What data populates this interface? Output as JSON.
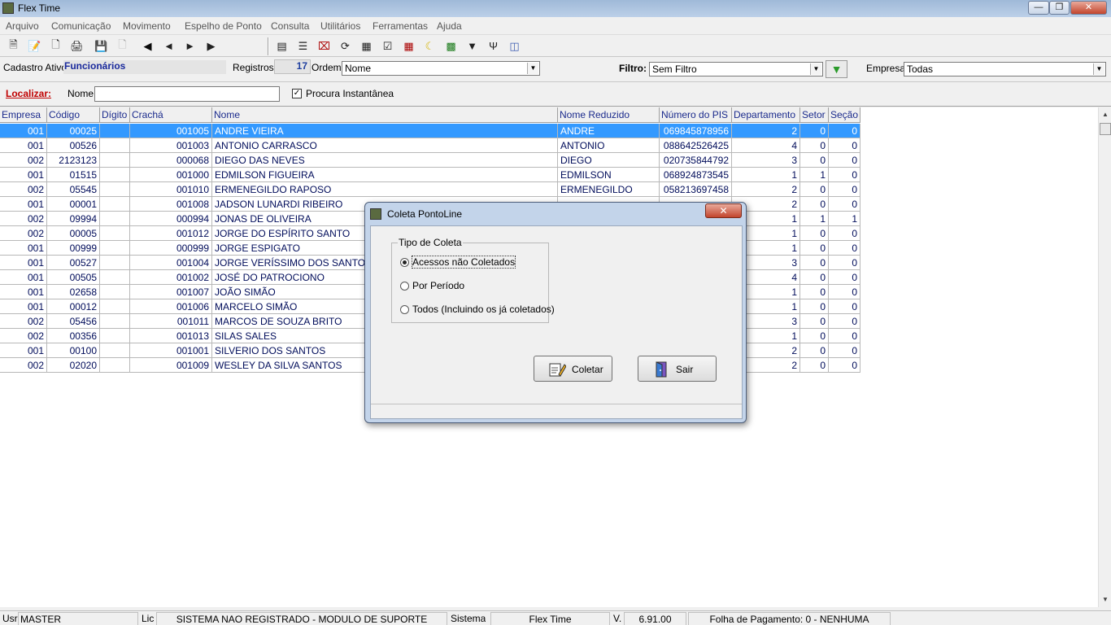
{
  "window": {
    "title": "Flex Time"
  },
  "menu": [
    "Arquivo",
    "Comunicação",
    "Movimento",
    "Espelho de Ponto",
    "Consulta",
    "Utilitários",
    "Ferramentas",
    "Ajuda"
  ],
  "toolbar": {
    "left_icons": [
      "new-record-icon",
      "edit-record-icon",
      "copy-record-icon",
      "print-icon",
      "save-icon",
      "blank-document-icon"
    ],
    "nav_icons": [
      "first-record-icon",
      "previous-record-icon",
      "next-record-icon",
      "last-record-icon"
    ],
    "right_icons": [
      "report-icon",
      "list-icon",
      "close-box-icon",
      "refresh-icon",
      "grid-icon",
      "checklist-icon",
      "calendar-icon",
      "moon-icon",
      "excel-icon",
      "filter-funnel-icon",
      "fork-icon",
      "network-icon"
    ]
  },
  "cadastro": {
    "label": "Cadastro Ativo:",
    "value": "Funcionários"
  },
  "registros": {
    "label": "Registros:",
    "count": "17"
  },
  "ordem": {
    "label": "Ordem:",
    "value": "Nome"
  },
  "filtro": {
    "label": "Filtro:",
    "value": "Sem Filtro"
  },
  "empresa": {
    "label": "Empresa:",
    "value": "Todas"
  },
  "localizar": {
    "label": "Localizar:",
    "field_label": "Nome",
    "value": "",
    "checkbox_label": "Procura Instantânea",
    "checked": true
  },
  "grid": {
    "columns": [
      "Empresa",
      "Código",
      "Dígito",
      "Crachá",
      "Nome",
      "Nome Reduzido",
      "Número do PIS",
      "Departamento",
      "Setor",
      "Seção"
    ],
    "rows": [
      [
        "001",
        "00025",
        "",
        "001005",
        "ANDRE VIEIRA",
        "ANDRE",
        "069845878956",
        "2",
        "0",
        "0"
      ],
      [
        "001",
        "00526",
        "",
        "001003",
        "ANTONIO CARRASCO",
        "ANTONIO",
        "088642526425",
        "4",
        "0",
        "0"
      ],
      [
        "002",
        "2123123",
        "",
        "000068",
        "DIEGO DAS NEVES",
        "DIEGO",
        "020735844792",
        "3",
        "0",
        "0"
      ],
      [
        "001",
        "01515",
        "",
        "001000",
        "EDMILSON FIGUEIRA",
        "EDMILSON",
        "068924873545",
        "1",
        "1",
        "0"
      ],
      [
        "002",
        "05545",
        "",
        "001010",
        "ERMENEGILDO RAPOSO",
        "ERMENEGILDO",
        "058213697458",
        "2",
        "0",
        "0"
      ],
      [
        "001",
        "00001",
        "",
        "001008",
        "JADSON LUNARDI RIBEIRO",
        "",
        "",
        "2",
        "0",
        "0"
      ],
      [
        "002",
        "09994",
        "",
        "000994",
        "JONAS DE OLIVEIRA",
        "",
        "",
        "1",
        "1",
        "1"
      ],
      [
        "002",
        "00005",
        "",
        "001012",
        "JORGE DO ESPÍRITO SANTO",
        "",
        "",
        "1",
        "0",
        "0"
      ],
      [
        "001",
        "00999",
        "",
        "000999",
        "JORGE ESPIGATO",
        "",
        "",
        "1",
        "0",
        "0"
      ],
      [
        "001",
        "00527",
        "",
        "001004",
        "JORGE VERÍSSIMO DOS SANTOS",
        "",
        "",
        "3",
        "0",
        "0"
      ],
      [
        "001",
        "00505",
        "",
        "001002",
        "JOSÉ DO PATROCIONO",
        "",
        "",
        "4",
        "0",
        "0"
      ],
      [
        "001",
        "02658",
        "",
        "001007",
        "JOÃO SIMÃO",
        "",
        "",
        "1",
        "0",
        "0"
      ],
      [
        "001",
        "00012",
        "",
        "001006",
        "MARCELO SIMÃO",
        "",
        "",
        "1",
        "0",
        "0"
      ],
      [
        "002",
        "05456",
        "",
        "001011",
        "MARCOS DE SOUZA BRITO",
        "",
        "",
        "3",
        "0",
        "0"
      ],
      [
        "002",
        "00356",
        "",
        "001013",
        "SILAS SALES",
        "",
        "",
        "1",
        "0",
        "0"
      ],
      [
        "001",
        "00100",
        "",
        "001001",
        "SILVERIO DOS SANTOS",
        "",
        "",
        "2",
        "0",
        "0"
      ],
      [
        "002",
        "02020",
        "",
        "001009",
        "WESLEY DA SILVA SANTOS",
        "",
        "",
        "2",
        "0",
        "0"
      ]
    ]
  },
  "statusbar": {
    "usr_label": "Usr",
    "usr_value": "MASTER",
    "lic_label": "Lic",
    "lic_value": "SISTEMA NAO REGISTRADO - MODULO DE SUPORTE",
    "sistema_label": "Sistema",
    "sistema_value": "Flex Time",
    "version_label": "V.",
    "version_value": "6.91.00",
    "folha": "Folha de Pagamento: 0 - NENHUMA"
  },
  "dialog": {
    "title": "Coleta PontoLine",
    "group_label": "Tipo de Coleta",
    "options": [
      "Acessos não Coletados",
      "Por Período",
      "Todos (Incluindo os já coletados)"
    ],
    "selected_option": "Acessos não Coletados",
    "coletar_label": "Coletar",
    "sair_label": "Sair"
  }
}
